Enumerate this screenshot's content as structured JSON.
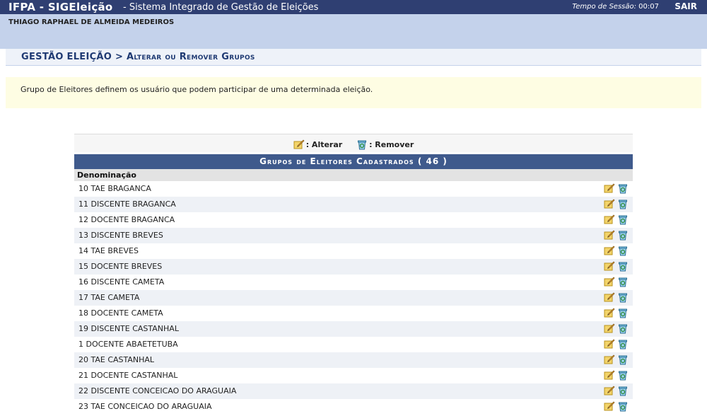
{
  "header": {
    "app_name": "IFPA - SIGEleição",
    "app_desc": "- Sistema Integrado de Gestão de Eleições",
    "session_label": "Tempo de Sessão:",
    "session_time": "00:07",
    "logout": "SAIR"
  },
  "user": {
    "name": "THIAGO RAPHAEL DE ALMEIDA MEDEIROS"
  },
  "breadcrumb": {
    "root": "GESTÃO ELEIÇÃO",
    "sep": ">",
    "page": "Alterar ou Remover Grupos"
  },
  "info": {
    "text": "Grupo de Eleitores definem os usuário que podem participar de uma determinada eleição."
  },
  "legend": {
    "edit_label": ": Alterar",
    "remove_label": ": Remover"
  },
  "table": {
    "caption": "Grupos de Eleitores Cadastrados ( 46 )",
    "column": "Denominação",
    "rows": [
      "10 TAE BRAGANCA",
      "11 DISCENTE BRAGANCA",
      "12 DOCENTE BRAGANCA",
      "13 DISCENTE BREVES",
      "14 TAE BREVES",
      "15 DOCENTE BREVES",
      "16 DISCENTE CAMETA",
      "17 TAE CAMETA",
      "18 DOCENTE CAMETA",
      "19 DISCENTE CASTANHAL",
      "1 DOCENTE ABAETETUBA",
      "20 TAE CASTANHAL",
      "21 DOCENTE CASTANHAL",
      "22 DISCENTE CONCEICAO DO ARAGUAIA",
      "23 TAE CONCEICAO DO ARAGUAIA"
    ]
  },
  "icons": {
    "edit": "pencil-note-icon",
    "remove": "trash-bin-icon"
  },
  "colors": {
    "header_bg": "#2f3f72",
    "user_bg": "#c4d2eb",
    "caption_bg": "#3f5a8c",
    "info_bg": "#fefde3"
  }
}
